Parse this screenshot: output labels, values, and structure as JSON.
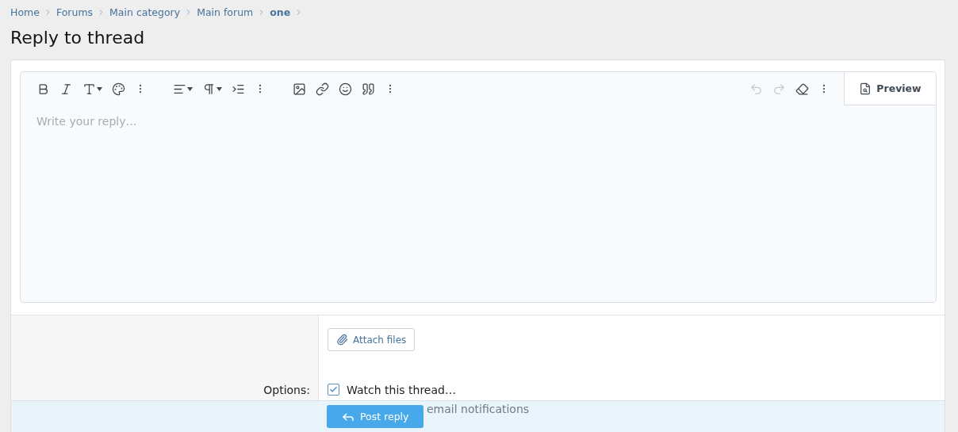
{
  "breadcrumb": [
    {
      "label": "Home",
      "current": false
    },
    {
      "label": "Forums",
      "current": false
    },
    {
      "label": "Main category",
      "current": false
    },
    {
      "label": "Main forum",
      "current": false
    },
    {
      "label": "one",
      "current": true
    }
  ],
  "title": "Reply to thread",
  "editor": {
    "undo": {
      "disabled": true
    },
    "redo": {
      "disabled": true
    },
    "preview_button": "Preview",
    "placeholder": "Write your reply…"
  },
  "attach_button": "Attach files",
  "options_label": "Options:",
  "options": [
    {
      "label": "Watch this thread…",
      "checked": true
    }
  ],
  "sub_option": {
    "label": "email notifications"
  },
  "submit_button": "Post reply"
}
